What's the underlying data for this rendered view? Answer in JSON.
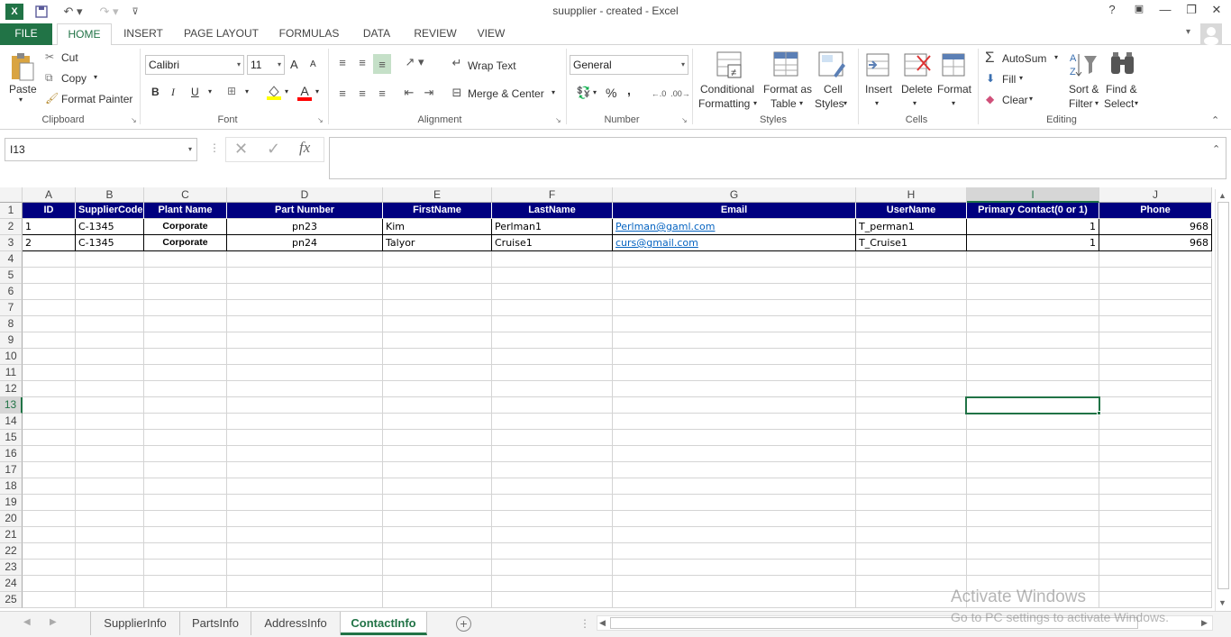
{
  "window": {
    "title": "suupplier - created - Excel",
    "help": "?",
    "minimize": "—",
    "restore": "❐",
    "close": "✕"
  },
  "tabs": [
    {
      "label": "FILE"
    },
    {
      "label": "HOME"
    },
    {
      "label": "INSERT"
    },
    {
      "label": "PAGE LAYOUT"
    },
    {
      "label": "FORMULAS"
    },
    {
      "label": "DATA"
    },
    {
      "label": "REVIEW"
    },
    {
      "label": "VIEW"
    }
  ],
  "ribbon": {
    "clipboard": {
      "paste": "Paste",
      "cut": "Cut",
      "copy": "Copy",
      "format_painter": "Format Painter",
      "label": "Clipboard"
    },
    "font": {
      "name": "Calibri",
      "size": "11",
      "label": "Font",
      "bold": "B",
      "italic": "I",
      "underline": "U",
      "grow": "A",
      "shrink": "A",
      "font_color": "A"
    },
    "alignment": {
      "wrap_text": "Wrap Text",
      "merge_center": "Merge & Center",
      "label": "Alignment"
    },
    "number": {
      "format": "General",
      "percent": "%",
      "comma": ",",
      "label": "Number"
    },
    "styles": {
      "conditional": "Conditional",
      "conditional2": "Formatting",
      "format_as": "Format as",
      "format_as2": "Table",
      "cell": "Cell",
      "cell2": "Styles",
      "label": "Styles"
    },
    "cells": {
      "insert": "Insert",
      "delete": "Delete",
      "format": "Format",
      "label": "Cells"
    },
    "editing": {
      "autosum": "AutoSum",
      "fill": "Fill",
      "clear": "Clear",
      "sort": "Sort &",
      "sort2": "Filter",
      "find": "Find &",
      "find2": "Select",
      "label": "Editing"
    }
  },
  "formula_bar": {
    "name_box": "I13",
    "fx": "fx",
    "value": ""
  },
  "columns": [
    "A",
    "B",
    "C",
    "D",
    "E",
    "F",
    "G",
    "H",
    "I",
    "J"
  ],
  "rows": [
    "1",
    "2",
    "3",
    "4",
    "5",
    "6",
    "7",
    "8",
    "9",
    "10",
    "11",
    "12",
    "13",
    "14",
    "15",
    "16",
    "17",
    "18",
    "19",
    "20",
    "21",
    "22",
    "23",
    "24",
    "25"
  ],
  "headers": [
    "ID",
    "SupplierCode",
    "Plant Name",
    "Part Number",
    "FirstName",
    "LastName",
    "Email",
    "UserName",
    "Primary Contact(0 or 1)",
    "Phone"
  ],
  "data": [
    [
      "1",
      "C-1345",
      "Corporate",
      "pn23",
      "Kim",
      "Perlman1",
      "Perlman@gaml.com",
      "T_perman1",
      "1",
      "968"
    ],
    [
      "2",
      "C-1345",
      "Corporate",
      "pn24",
      "Talyor",
      "Cruise1",
      "curs@gmail.com",
      "T_Cruise1",
      "1",
      "968"
    ]
  ],
  "selected_cell": "I13",
  "sheets": [
    {
      "label": "SupplierInfo"
    },
    {
      "label": "PartsInfo"
    },
    {
      "label": "AddressInfo"
    },
    {
      "label": "ContactInfo"
    }
  ],
  "watermark": {
    "line1": "Activate Windows",
    "line2": "Go to PC settings to activate Windows."
  },
  "colors": {
    "accent": "#217346",
    "header_fill": "#00007f",
    "link": "#0563c1"
  }
}
